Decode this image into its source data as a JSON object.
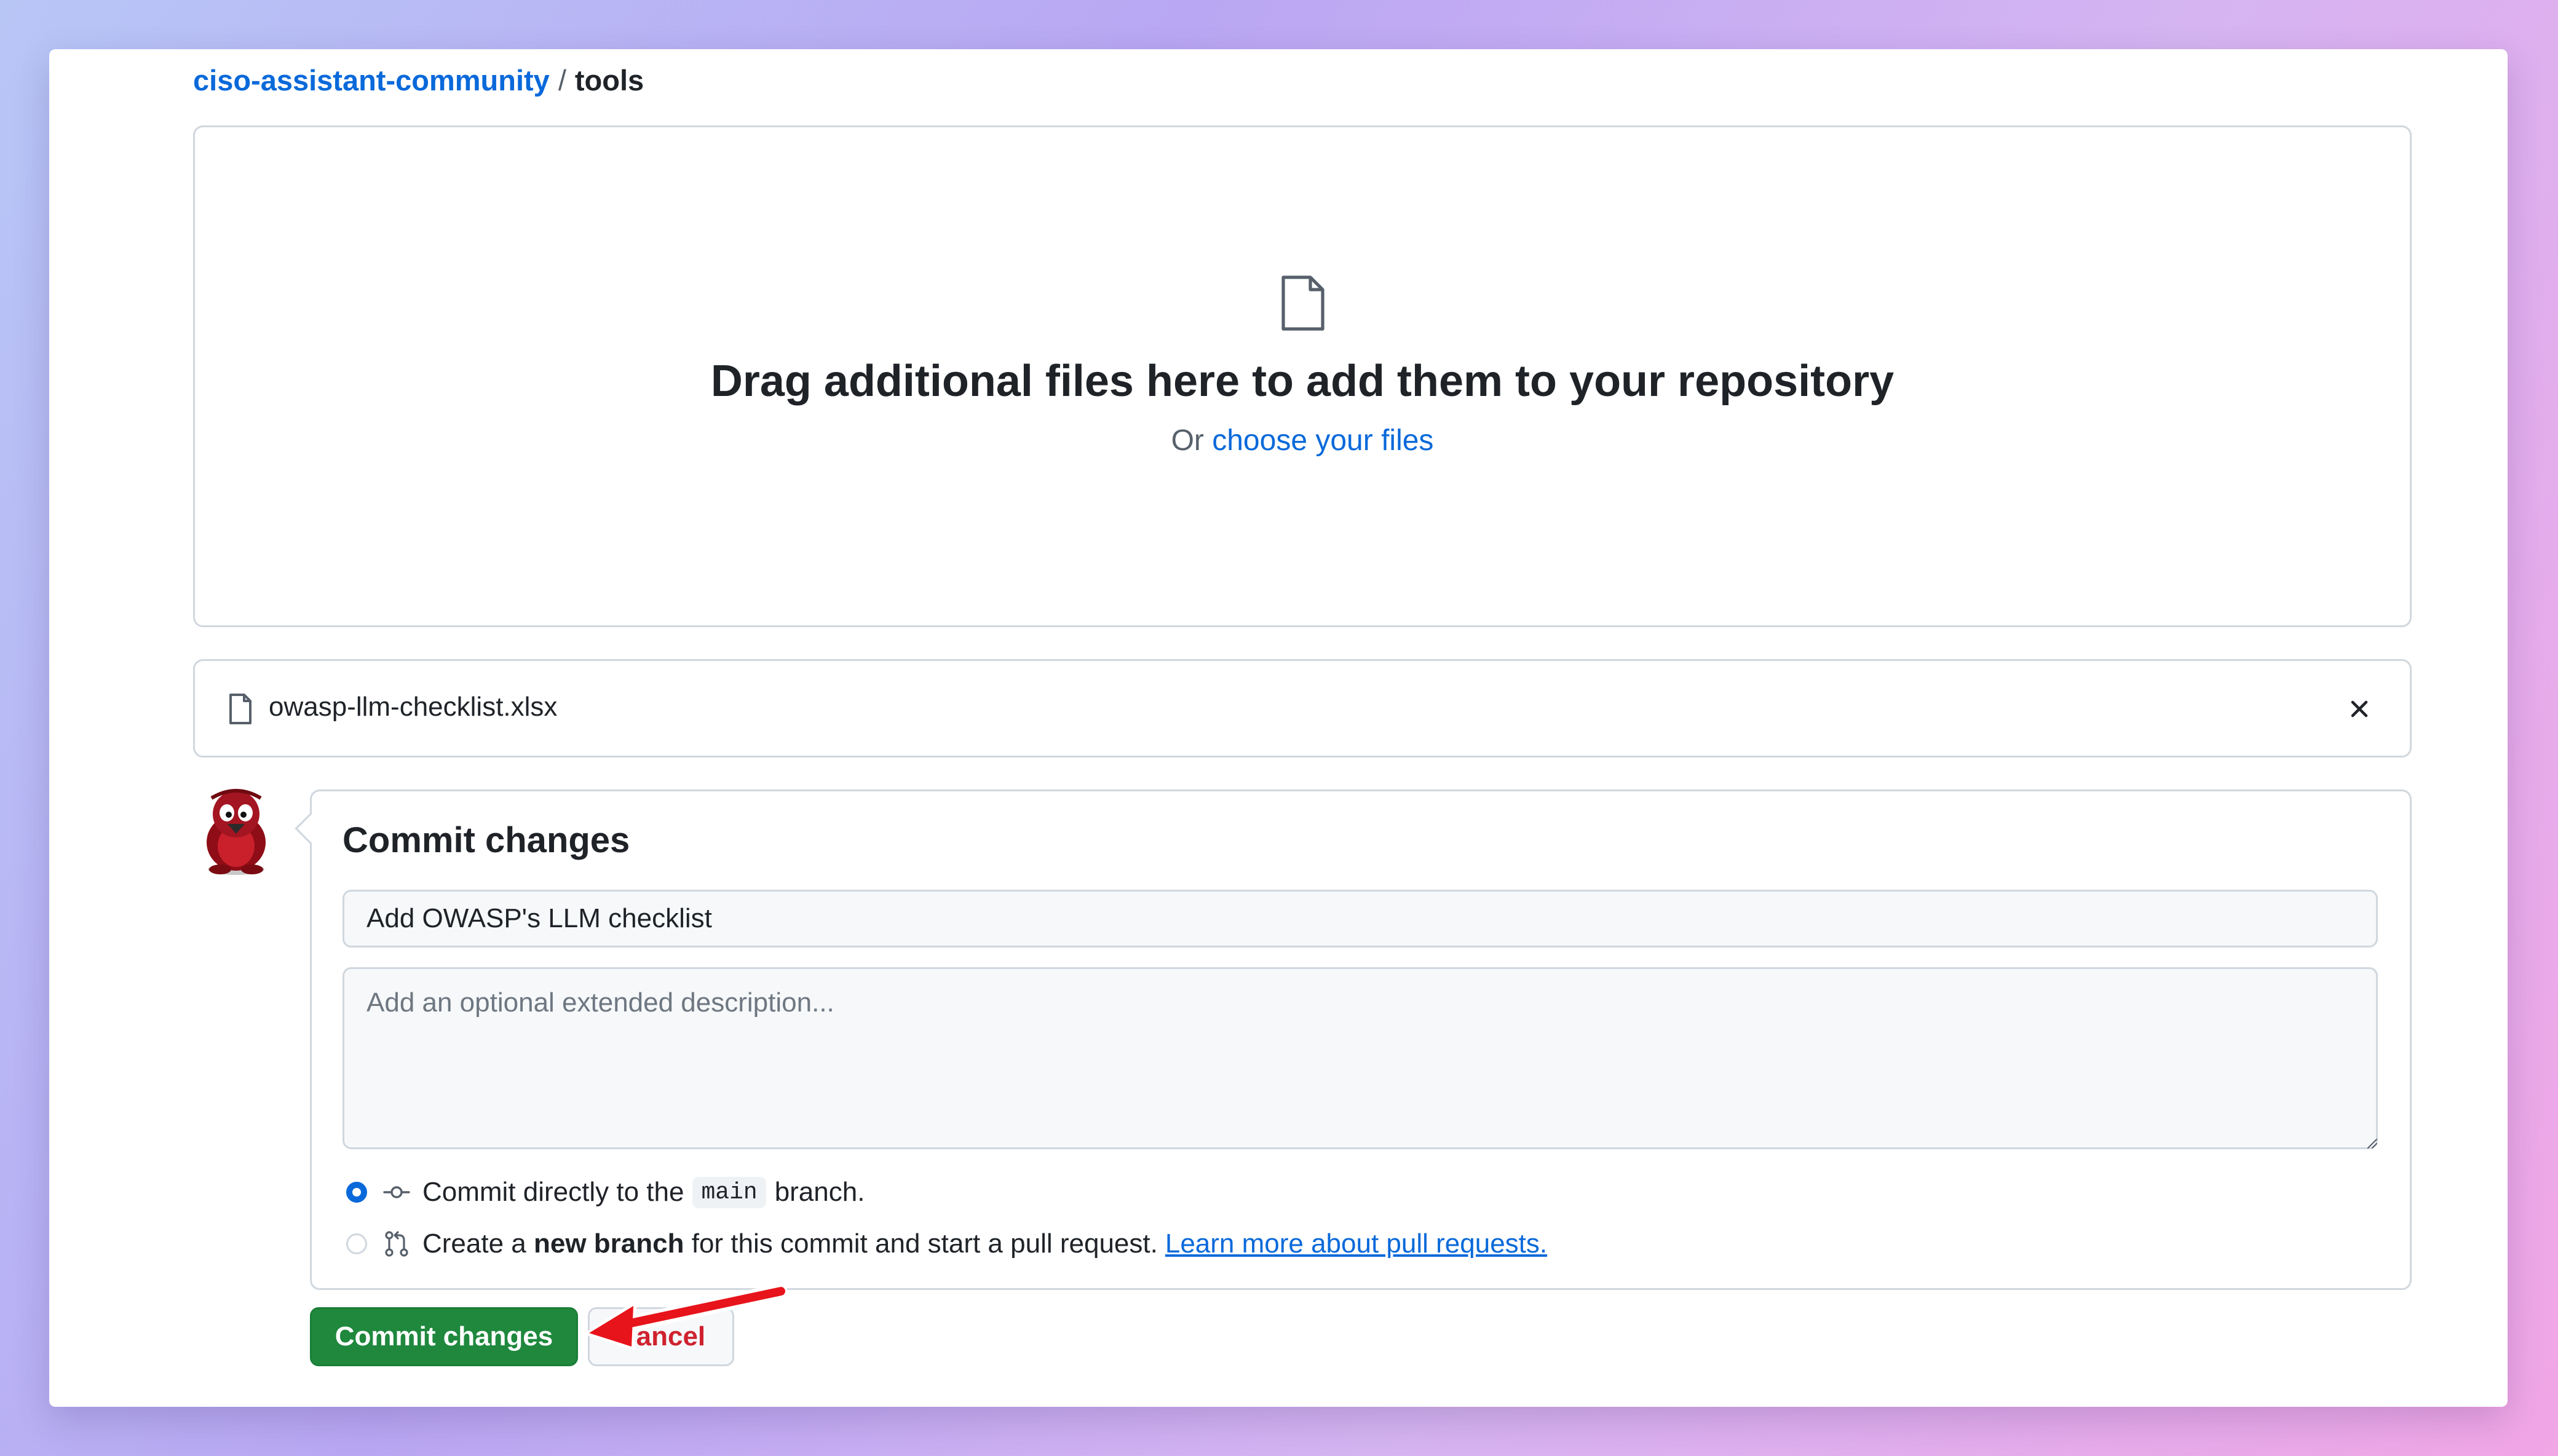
{
  "breadcrumb": {
    "owner": "ciso-assistant-community",
    "separator": "/",
    "repo": "tools"
  },
  "dropzone": {
    "icon": "file-icon",
    "title": "Drag additional files here to add them to your repository",
    "or_text": "Or",
    "choose_link": "choose your files"
  },
  "uploaded_file": {
    "icon": "file-icon",
    "name": "owasp-llm-checklist.xlsx",
    "remove_icon": "close-icon"
  },
  "commit": {
    "title": "Commit changes",
    "summary_value": "Add OWASP's LLM checklist",
    "description_placeholder": "Add an optional extended description...",
    "options": {
      "direct": {
        "selected": true,
        "icon": "git-commit-icon",
        "prefix": "Commit directly to the",
        "branch": "main",
        "suffix": "branch."
      },
      "new_branch": {
        "selected": false,
        "icon": "git-pull-request-icon",
        "prefix": "Create a",
        "bold": "new branch",
        "suffix": "for this commit and start a pull request.",
        "link": "Learn more about pull requests."
      }
    }
  },
  "buttons": {
    "commit": "Commit changes",
    "cancel": "Cancel"
  },
  "colors": {
    "link": "#0969da",
    "primary_button": "#1f883d",
    "cancel_text": "#cf222e",
    "annotation_arrow": "#e8141b"
  }
}
